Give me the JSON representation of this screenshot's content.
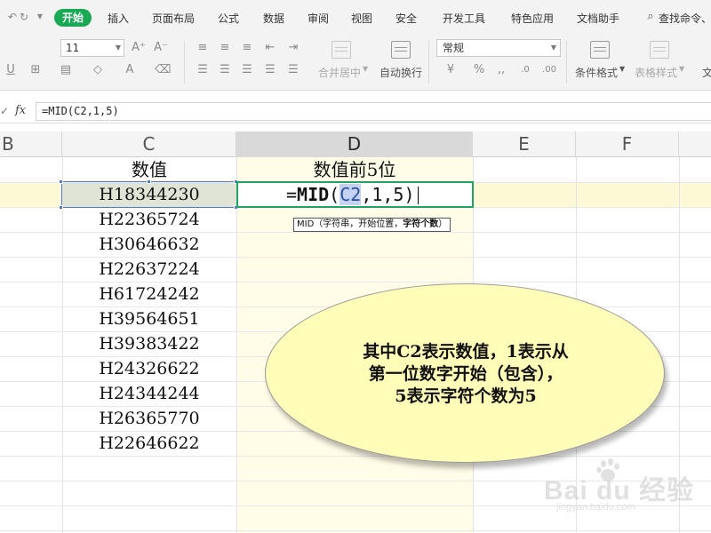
{
  "menubar": {
    "items": [
      "开始",
      "插入",
      "页面布局",
      "公式",
      "数据",
      "审阅",
      "视图",
      "安全",
      "开发工具",
      "特色应用",
      "文档助手",
      "查找命令、"
    ],
    "active_index": 0,
    "active_color": "#1aaa55"
  },
  "ribbon": {
    "font_size": "11",
    "number_format": "常规",
    "merge_label": "合并居中",
    "wrap_label": "自动换行",
    "cond_format_label": "条件格式",
    "table_style_label": "表格样式",
    "clipped_label": "文"
  },
  "formula_bar": {
    "fx_label": "fx",
    "content": "=MID(C2,1,5)"
  },
  "columns": [
    "B",
    "C",
    "D",
    "E",
    "F"
  ],
  "selected_column": "D",
  "sheet": {
    "header_c": "数值",
    "header_d": "数值前5位",
    "values": [
      "H18344230",
      "H22365724",
      "H30646632",
      "H22637224",
      "H61724242",
      "H39564651",
      "H39383422",
      "H24326622",
      "H24344244",
      "H26365770",
      "H22646622"
    ],
    "formula_edit": {
      "prefix": "=",
      "fname": "MID",
      "open": "(",
      "ref": "C2",
      "rest": ",1,5",
      "close": ")"
    },
    "tooltip_plain": "MID（字符串，开始位置，",
    "tooltip_bold": "字符个数",
    "tooltip_end": "）"
  },
  "callout": {
    "lines": [
      "其中C2表示数值，1表示从",
      "第一位数字开始（包含），",
      "5表示字符个数为5"
    ],
    "fill_color": "#fffdb8"
  },
  "watermark": {
    "main": "Bai du 经验",
    "sub": "jingyan.baidu.com"
  },
  "icons": [
    "undo-icon",
    "redo-icon",
    "dropdown-icon",
    "search-icon"
  ]
}
